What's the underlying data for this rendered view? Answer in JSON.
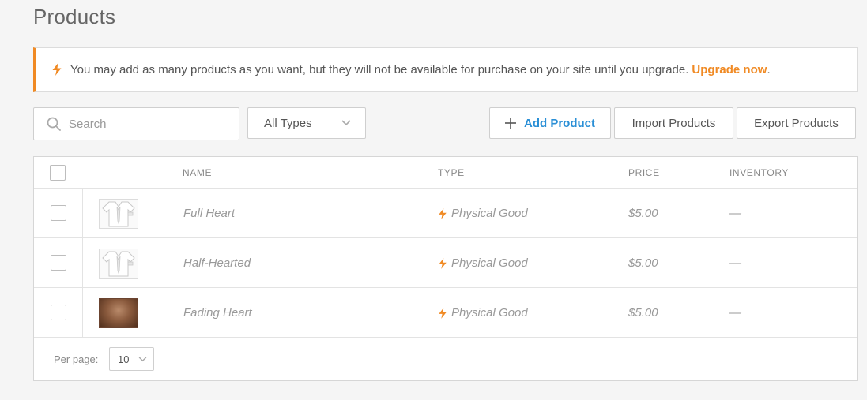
{
  "page": {
    "title": "Products"
  },
  "notice": {
    "text": "You may add as many products as you want, but they will not be available for purchase on your site until you upgrade.",
    "link_label": "Upgrade now",
    "trailing": ".",
    "icon": "lightning-icon",
    "accent_color": "#f08a24"
  },
  "toolbar": {
    "search_placeholder": "Search",
    "type_filter": {
      "selected": "All Types"
    },
    "add_label": "Add Product",
    "import_label": "Import Products",
    "export_label": "Export Products"
  },
  "table": {
    "columns": [
      "NAME",
      "TYPE",
      "PRICE",
      "INVENTORY"
    ],
    "rows": [
      {
        "name": "Full Heart",
        "type": "Physical Good",
        "price": "$5.00",
        "inventory": "—",
        "thumbnail": "shirt-placeholder-icon"
      },
      {
        "name": "Half-Hearted",
        "type": "Physical Good",
        "price": "$5.00",
        "inventory": "—",
        "thumbnail": "shirt-placeholder-icon"
      },
      {
        "name": "Fading Heart",
        "type": "Physical Good",
        "price": "$5.00",
        "inventory": "—",
        "thumbnail": "product-photo"
      }
    ]
  },
  "pagination": {
    "label": "Per page:",
    "value": "10"
  }
}
